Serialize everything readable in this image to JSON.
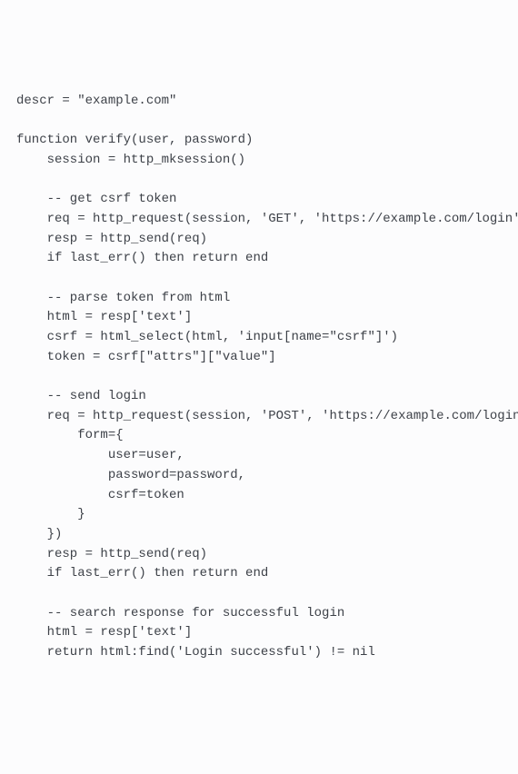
{
  "code": {
    "line1": "descr = \"example.com\"",
    "line2": "",
    "line3": "function verify(user, password)",
    "line4": "    session = http_mksession()",
    "line5": "",
    "line6": "    -- get csrf token",
    "line7": "    req = http_request(session, 'GET', 'https://example.com/login',",
    "line8": "    resp = http_send(req)",
    "line9": "    if last_err() then return end",
    "line10": "",
    "line11": "    -- parse token from html",
    "line12": "    html = resp['text']",
    "line13": "    csrf = html_select(html, 'input[name=\"csrf\"]')",
    "line14": "    token = csrf[\"attrs\"][\"value\"]",
    "line15": "",
    "line16": "    -- send login",
    "line17": "    req = http_request(session, 'POST', 'https://example.com/login',",
    "line18": "        form={",
    "line19": "            user=user,",
    "line20": "            password=password,",
    "line21": "            csrf=token",
    "line22": "        }",
    "line23": "    })",
    "line24": "    resp = http_send(req)",
    "line25": "    if last_err() then return end",
    "line26": "",
    "line27": "    -- search response for successful login",
    "line28": "    html = resp['text']",
    "line29": "    return html:find('Login successful') != nil"
  }
}
